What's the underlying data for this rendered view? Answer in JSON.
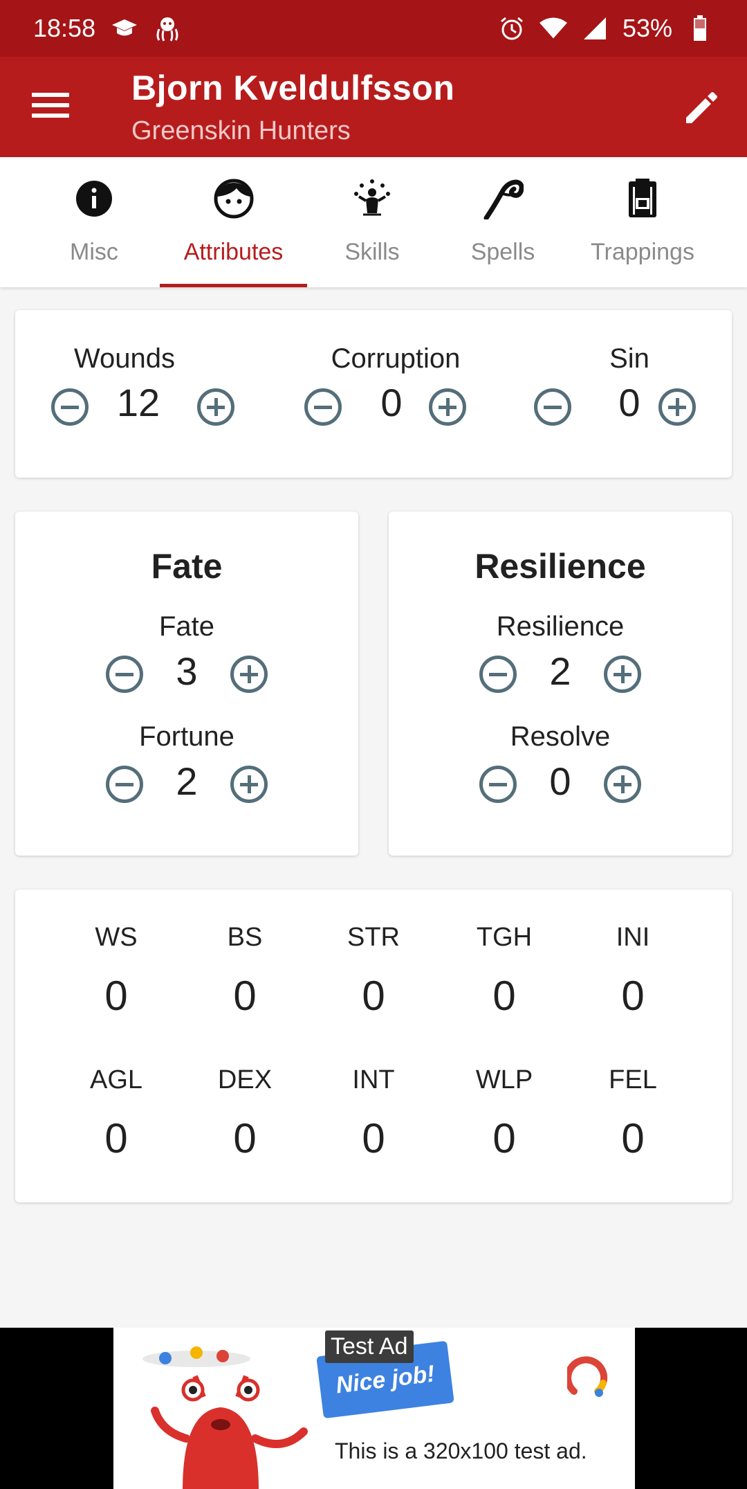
{
  "status_bar": {
    "time": "18:58",
    "battery": "53%",
    "left_icons": [
      "graduation-cap-icon",
      "octopus-icon"
    ],
    "right_icons": [
      "alarm-icon",
      "wifi-icon",
      "signal-icon",
      "battery-icon"
    ]
  },
  "app_bar": {
    "title": "Bjorn Kveldulfsson",
    "subtitle": "Greenskin Hunters",
    "menu_icon": "hamburger-menu-icon",
    "edit_icon": "pencil-icon"
  },
  "tabs": [
    {
      "label": "Misc",
      "icon": "info-icon",
      "active": false
    },
    {
      "label": "Attributes",
      "icon": "face-icon",
      "active": true
    },
    {
      "label": "Skills",
      "icon": "juggler-icon",
      "active": false
    },
    {
      "label": "Spells",
      "icon": "magic-swirl-icon",
      "active": false
    },
    {
      "label": "Trappings",
      "icon": "backpack-icon",
      "active": false
    }
  ],
  "status_counters": {
    "wounds": {
      "label": "Wounds",
      "value": "12"
    },
    "corruption": {
      "label": "Corruption",
      "value": "0"
    },
    "sin": {
      "label": "Sin",
      "value": "0"
    }
  },
  "fate_panel": {
    "title": "Fate",
    "fate": {
      "label": "Fate",
      "value": "3"
    },
    "fortune": {
      "label": "Fortune",
      "value": "2"
    }
  },
  "resilience_panel": {
    "title": "Resilience",
    "resilience": {
      "label": "Resilience",
      "value": "2"
    },
    "resolve": {
      "label": "Resolve",
      "value": "0"
    }
  },
  "characteristics": [
    {
      "label": "WS",
      "value": "0"
    },
    {
      "label": "BS",
      "value": "0"
    },
    {
      "label": "STR",
      "value": "0"
    },
    {
      "label": "TGH",
      "value": "0"
    },
    {
      "label": "INI",
      "value": "0"
    },
    {
      "label": "AGL",
      "value": "0"
    },
    {
      "label": "DEX",
      "value": "0"
    },
    {
      "label": "INT",
      "value": "0"
    },
    {
      "label": "WLP",
      "value": "0"
    },
    {
      "label": "FEL",
      "value": "0"
    }
  ],
  "ad": {
    "badge": "Test Ad",
    "flag_text": "Nice job!",
    "body": "This is a 320x100 test ad."
  },
  "colors": {
    "status_bar": "#a51417",
    "app_bar": "#b71c1c",
    "accent": "#b71c1c",
    "button_outline": "#546e7a"
  }
}
